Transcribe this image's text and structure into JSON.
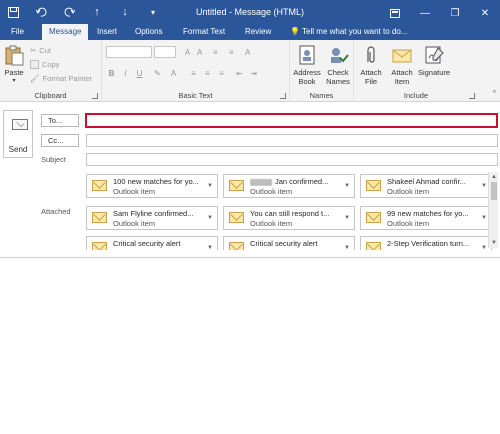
{
  "titlebar": {
    "title": "Untitled - Message (HTML)",
    "save_icon": "save-icon",
    "undo_icon": "undo-icon",
    "redo_icon": "redo-icon",
    "up_icon": "arrow-up-icon",
    "down_icon": "arrow-down-icon",
    "customize_icon": "customize-qat-icon",
    "ribbon_display_icon": "ribbon-display-icon",
    "minimize_glyph": "—",
    "restore_glyph": "❐",
    "close_glyph": "✕",
    "accent": "#2b579a"
  },
  "tabs": [
    {
      "label": "File"
    },
    {
      "label": "Message"
    },
    {
      "label": "Insert"
    },
    {
      "label": "Options"
    },
    {
      "label": "Format Text"
    },
    {
      "label": "Review"
    }
  ],
  "tellme": {
    "placeholder": "Tell me what you want to do..."
  },
  "ribbon": {
    "clipboard": {
      "label": "Clipboard",
      "paste": "Paste",
      "cut": "Cut",
      "copy": "Copy",
      "format_painter": "Format Painter"
    },
    "basic_text": {
      "label": "Basic Text",
      "bold": "B",
      "italic": "I",
      "underline": "U"
    },
    "names": {
      "label": "Names",
      "address_book": "Address Book",
      "check_names": "Check Names"
    },
    "include": {
      "label": "Include",
      "attach_file": "Attach File",
      "attach_item": "Attach Item",
      "signature": "Signature"
    }
  },
  "compose": {
    "send": "Send",
    "to": "To...",
    "cc": "Cc...",
    "subject": "Subject",
    "attached": "Attached"
  },
  "attachments": [
    {
      "name": "100 new matches for yo...",
      "type": "Outlook item"
    },
    {
      "name": "Jan confirmed...",
      "type": "Outlook item",
      "redacted": true
    },
    {
      "name": "Shakeel Ahmad confir...",
      "type": "Outlook item"
    },
    {
      "name": "Sam Flyline confirmed...",
      "type": "Outlook item"
    },
    {
      "name": "You can still respond t...",
      "type": "Outlook item"
    },
    {
      "name": "99 new matches for yo...",
      "type": "Outlook item"
    },
    {
      "name": "Critical security alert",
      "type": "Outlook item"
    },
    {
      "name": "Critical security alert",
      "type": "Outlook item"
    },
    {
      "name": "2-Step Verification turn...",
      "type": "Outlook item"
    }
  ]
}
